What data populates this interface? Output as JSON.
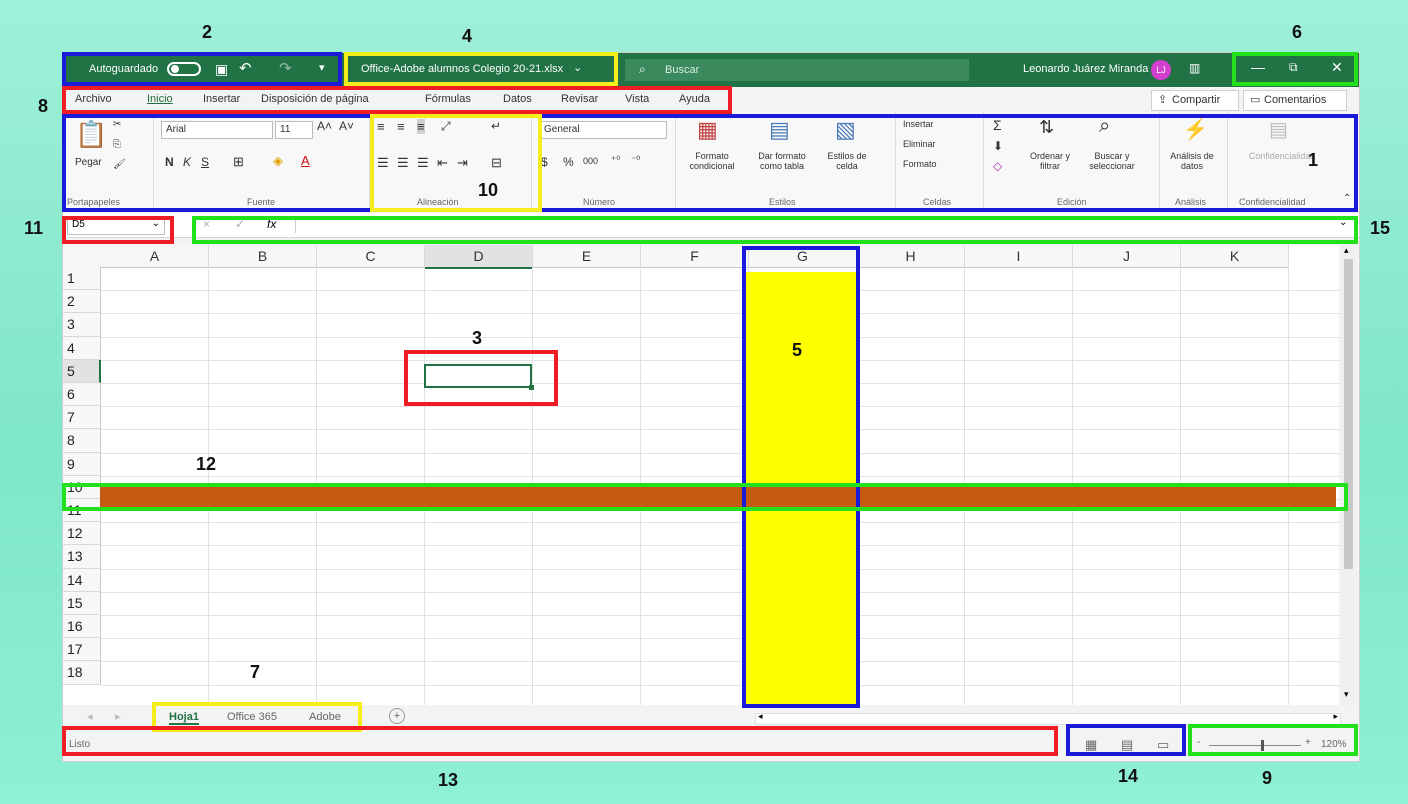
{
  "titlebar": {
    "autosave_label": "Autoguardado",
    "file_name": "Office-Adobe alumnos Colegio 20-21.xlsx",
    "search_placeholder": "Buscar",
    "user_name": "Leonardo Juárez Miranda",
    "user_initials": "LJ"
  },
  "menu": {
    "items": [
      "Archivo",
      "Inicio",
      "Insertar",
      "Disposición de página",
      "Fórmulas",
      "Datos",
      "Revisar",
      "Vista",
      "Ayuda"
    ],
    "share_label": "Compartir",
    "comments_label": "Comentarios"
  },
  "ribbon": {
    "paste_label": "Pegar",
    "clipboard_group": "Portapapeles",
    "font_name": "Arial",
    "font_size": "11",
    "bold": "N",
    "italic": "K",
    "underline": "S",
    "font_group": "Fuente",
    "alignment_group": "Alineación",
    "number_format": "General",
    "currency": "$",
    "percent": "%",
    "thousands": "000",
    "number_group": "Número",
    "conditional_format": "Formato condicional",
    "format_as_table": "Dar formato como tabla",
    "cell_styles": "Estilos de celda",
    "styles_group": "Estilos",
    "insert": "Insertar",
    "delete": "Eliminar",
    "format": "Formato",
    "cells_group": "Celdas",
    "sort_filter": "Ordenar y filtrar",
    "find_select": "Buscar y seleccionar",
    "editing_group": "Edición",
    "data_analysis": "Análisis de datos",
    "analysis_group": "Análisis",
    "confidentiality": "Confidencialidad",
    "confidentiality_group": "Confidencialidad"
  },
  "formula": {
    "name_box": "D5",
    "cancel": "×",
    "enter": "✓",
    "fx": "fx",
    "content": ""
  },
  "grid": {
    "columns": [
      "A",
      "B",
      "C",
      "D",
      "E",
      "F",
      "G",
      "H",
      "I",
      "J",
      "K"
    ],
    "rows": [
      "1",
      "2",
      "3",
      "4",
      "5",
      "6",
      "7",
      "8",
      "9",
      "10",
      "11",
      "12",
      "13",
      "14",
      "15",
      "16",
      "17",
      "18"
    ]
  },
  "sheets": {
    "tabs": [
      "Hoja1",
      "Office 365",
      "Adobe"
    ],
    "active": "Hoja1",
    "add": "+"
  },
  "status": {
    "text": "Listo",
    "zoom": "120%",
    "zoom_minus": "-",
    "zoom_plus": "+"
  },
  "callouts": {
    "n1": "1",
    "n2": "2",
    "n3": "3",
    "n4": "4",
    "n5": "5",
    "n6": "6",
    "n7": "7",
    "n8": "8",
    "n9": "9",
    "n10": "10",
    "n11": "11",
    "n12": "12",
    "n13": "13",
    "n14": "14",
    "n15": "15"
  },
  "colors": {
    "excel_green": "#217346",
    "highlight_column": "#ffff00",
    "highlight_row": "#c55a11",
    "callout_red": "#ee1c24",
    "callout_blue": "#1a1ad8",
    "callout_yellow": "#f6ee1a",
    "callout_green": "#22e01a"
  }
}
